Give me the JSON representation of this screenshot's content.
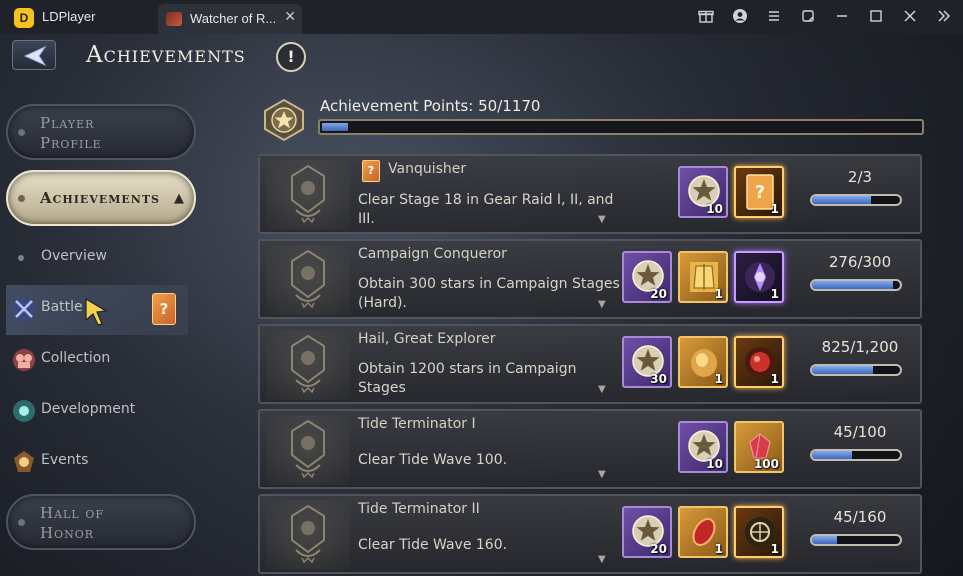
{
  "emulator": {
    "app_name": "LDPlayer",
    "logo_letter": "D",
    "tab_title": "Watcher of R...",
    "controls": [
      "gift-icon",
      "account-icon",
      "menu-icon",
      "resize-icon",
      "minimize-icon",
      "maximize-icon",
      "close-icon",
      "expand-sidebar-icon"
    ]
  },
  "header": {
    "title": "Achievements",
    "info_symbol": "!"
  },
  "menu": {
    "player_profile": "Player\nProfile",
    "achievements": "Achievements",
    "achievements_caret": "▲",
    "overview": "Overview",
    "battle": "Battle",
    "battle_badge": "?",
    "collection": "Collection",
    "development": "Development",
    "events": "Events",
    "hall_of_honor": "Hall of\nHonor"
  },
  "points": {
    "label": "Achievement Points: 50/1170",
    "current": 50,
    "total": 1170
  },
  "achievements": [
    {
      "title": "Vanquisher",
      "has_card": true,
      "card_symbol": "?",
      "description": "Clear Stage 18 in Gear Raid I, II, and III.",
      "rewards": [
        {
          "type": "purple",
          "icon": "star-medal-icon",
          "qty": "10"
        },
        {
          "type": "gold-glow",
          "icon": "mystery-card-icon",
          "qty": "1"
        }
      ],
      "progress_text": "2/3",
      "progress": 0.6667
    },
    {
      "title": "Campaign Conqueror",
      "has_card": false,
      "description": "Obtain 300 stars in Campaign Stages (Hard).",
      "rewards": [
        {
          "type": "purple",
          "icon": "star-medal-icon",
          "qty": "20"
        },
        {
          "type": "gold",
          "icon": "golden-armor-icon",
          "qty": "1"
        },
        {
          "type": "purple-dark",
          "icon": "purple-crest-icon",
          "qty": "1"
        }
      ],
      "progress_text": "276/300",
      "progress": 0.92
    },
    {
      "title": "Hail, Great Explorer",
      "has_card": false,
      "description": "Obtain 1200 stars in Campaign Stages",
      "rewards": [
        {
          "type": "purple",
          "icon": "star-medal-icon",
          "qty": "30"
        },
        {
          "type": "gold",
          "icon": "golden-gem-icon",
          "qty": "1"
        },
        {
          "type": "gold-glow",
          "icon": "red-orb-icon",
          "qty": "1"
        }
      ],
      "progress_text": "825/1,200",
      "progress": 0.6875
    },
    {
      "title": "Tide Terminator I",
      "has_card": false,
      "description": "Clear Tide Wave 100.",
      "rewards": [
        {
          "type": "purple",
          "icon": "star-medal-icon",
          "qty": "10"
        },
        {
          "type": "gold",
          "icon": "red-crystal-icon",
          "qty": "100"
        }
      ],
      "progress_text": "45/100",
      "progress": 0.45
    },
    {
      "title": "Tide Terminator II",
      "has_card": false,
      "description": "Clear Tide Wave 160.",
      "rewards": [
        {
          "type": "purple",
          "icon": "star-medal-icon",
          "qty": "20"
        },
        {
          "type": "gold",
          "icon": "red-gem-icon",
          "qty": "1"
        },
        {
          "type": "gold-glow",
          "icon": "dark-crest-icon",
          "qty": "1"
        }
      ],
      "progress_text": "45/160",
      "progress": 0.28
    }
  ],
  "colors": {
    "progress_blue": "#3e66b8",
    "active_menu": "#e7dfc9",
    "reward_purple": "#6f4fa8",
    "reward_gold": "#d89a3a"
  }
}
